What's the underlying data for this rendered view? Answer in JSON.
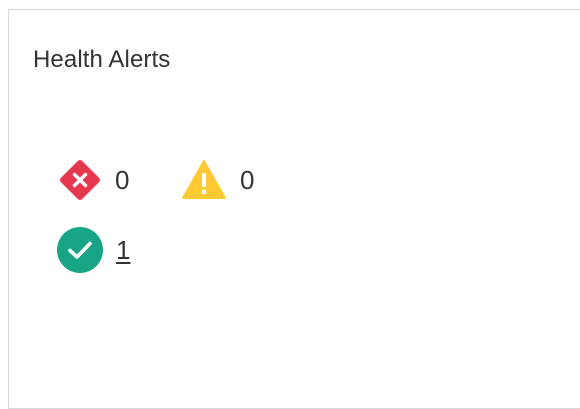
{
  "widget": {
    "title": "Health Alerts"
  },
  "alerts": {
    "critical": {
      "count": "0",
      "icon": "error-diamond-icon",
      "color": "#e5384f"
    },
    "warning": {
      "count": "0",
      "icon": "warning-triangle-icon",
      "color": "#ffc933"
    },
    "ok": {
      "count": "1",
      "icon": "check-circle-icon",
      "color": "#18a585"
    }
  }
}
